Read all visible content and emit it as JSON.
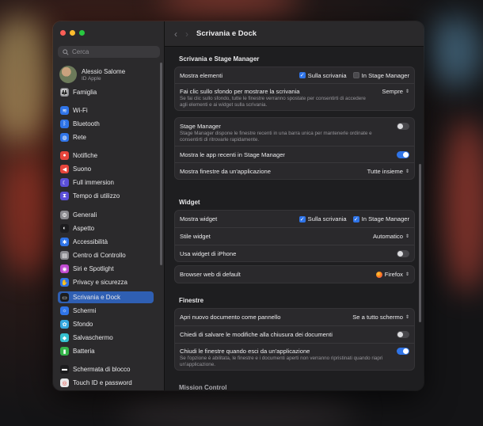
{
  "window": {
    "title": "Scrivania e Dock"
  },
  "sidebar": {
    "search_placeholder": "Cerca",
    "profile": {
      "name": "Alessio Salome",
      "subtitle": "ID Apple"
    },
    "items": [
      {
        "label": "Famiglia",
        "icon": "family-icon",
        "color": "#8a8a8f"
      },
      {
        "label": "Wi-Fi",
        "icon": "wifi-icon",
        "color": "#2f74e8"
      },
      {
        "label": "Bluetooth",
        "icon": "bluetooth-icon",
        "color": "#2f74e8"
      },
      {
        "label": "Rete",
        "icon": "globe-icon",
        "color": "#2f74e8"
      },
      {
        "label": "Notifiche",
        "icon": "bell-icon",
        "color": "#e8453c"
      },
      {
        "label": "Suono",
        "icon": "speaker-icon",
        "color": "#e8453c"
      },
      {
        "label": "Full immersion",
        "icon": "moon-icon",
        "color": "#5b4fd8"
      },
      {
        "label": "Tempo di utilizzo",
        "icon": "hourglass-icon",
        "color": "#5b4fd8"
      },
      {
        "label": "Generali",
        "icon": "gear-icon",
        "color": "#8a8a8f"
      },
      {
        "label": "Aspetto",
        "icon": "appearance-icon",
        "color": "#1c1c1e"
      },
      {
        "label": "Accessibilità",
        "icon": "accessibility-icon",
        "color": "#2f74e8"
      },
      {
        "label": "Centro di Controllo",
        "icon": "control-center-icon",
        "color": "#8a8a8f"
      },
      {
        "label": "Siri e Spotlight",
        "icon": "siri-icon",
        "color": "#c04ad0"
      },
      {
        "label": "Privacy e sicurezza",
        "icon": "hand-icon",
        "color": "#2f74e8"
      },
      {
        "label": "Scrivania e Dock",
        "icon": "dock-icon",
        "color": "#1c1c1e",
        "active": true
      },
      {
        "label": "Schermi",
        "icon": "display-icon",
        "color": "#2f74e8"
      },
      {
        "label": "Sfondo",
        "icon": "wallpaper-icon",
        "color": "#35a8e0"
      },
      {
        "label": "Salvaschermo",
        "icon": "screensaver-icon",
        "color": "#35c1d0"
      },
      {
        "label": "Batteria",
        "icon": "battery-icon",
        "color": "#35b54a"
      },
      {
        "label": "Schermata di blocco",
        "icon": "lock-screen-icon",
        "color": "#1c1c1e"
      },
      {
        "label": "Touch ID e password",
        "icon": "fingerprint-icon",
        "color": "#e8e8ea"
      }
    ]
  },
  "main": {
    "sections": {
      "stage": "Scrivania e Stage Manager",
      "widget": "Widget",
      "finestre": "Finestre",
      "mission": "Mission Control"
    },
    "rows": {
      "mostra_elementi": {
        "label": "Mostra elementi",
        "opt1": "Sulla scrivania",
        "opt2": "In Stage Manager"
      },
      "clic_sfondo": {
        "label": "Fai clic sullo sfondo per mostrare la scrivania",
        "desc": "Se fai clic sullo sfondo, tutte le finestre verranno spostate per consentirti di accedere agli elementi e ai widget sulla scrivania.",
        "value": "Sempre"
      },
      "stage_manager": {
        "label": "Stage Manager",
        "desc": "Stage Manager dispone le finestre recenti in una barra unica per mantenerle ordinate e consentirti di ritrovarle rapidamente."
      },
      "app_recenti": {
        "label": "Mostra le app recenti in Stage Manager"
      },
      "finestre_app": {
        "label": "Mostra finestre da un'applicazione",
        "value": "Tutte insieme"
      },
      "mostra_widget": {
        "label": "Mostra widget",
        "opt1": "Sulla scrivania",
        "opt2": "In Stage Manager"
      },
      "stile_widget": {
        "label": "Stile widget",
        "value": "Automatico"
      },
      "widget_iphone": {
        "label": "Usa widget di iPhone"
      },
      "browser": {
        "label": "Browser web di default",
        "value": "Firefox"
      },
      "apri_doc": {
        "label": "Apri nuovo documento come pannello",
        "value": "Se a tutto schermo"
      },
      "salvare": {
        "label": "Chiedi di salvare le modifiche alla chiusura dei documenti"
      },
      "chiudi": {
        "label": "Chiudi le finestre quando esci da un'applicazione",
        "desc": "Se l'opzione è abilitata, le finestre e i documenti aperti non verranno ripristinati quando riapri un'applicazione."
      }
    }
  }
}
